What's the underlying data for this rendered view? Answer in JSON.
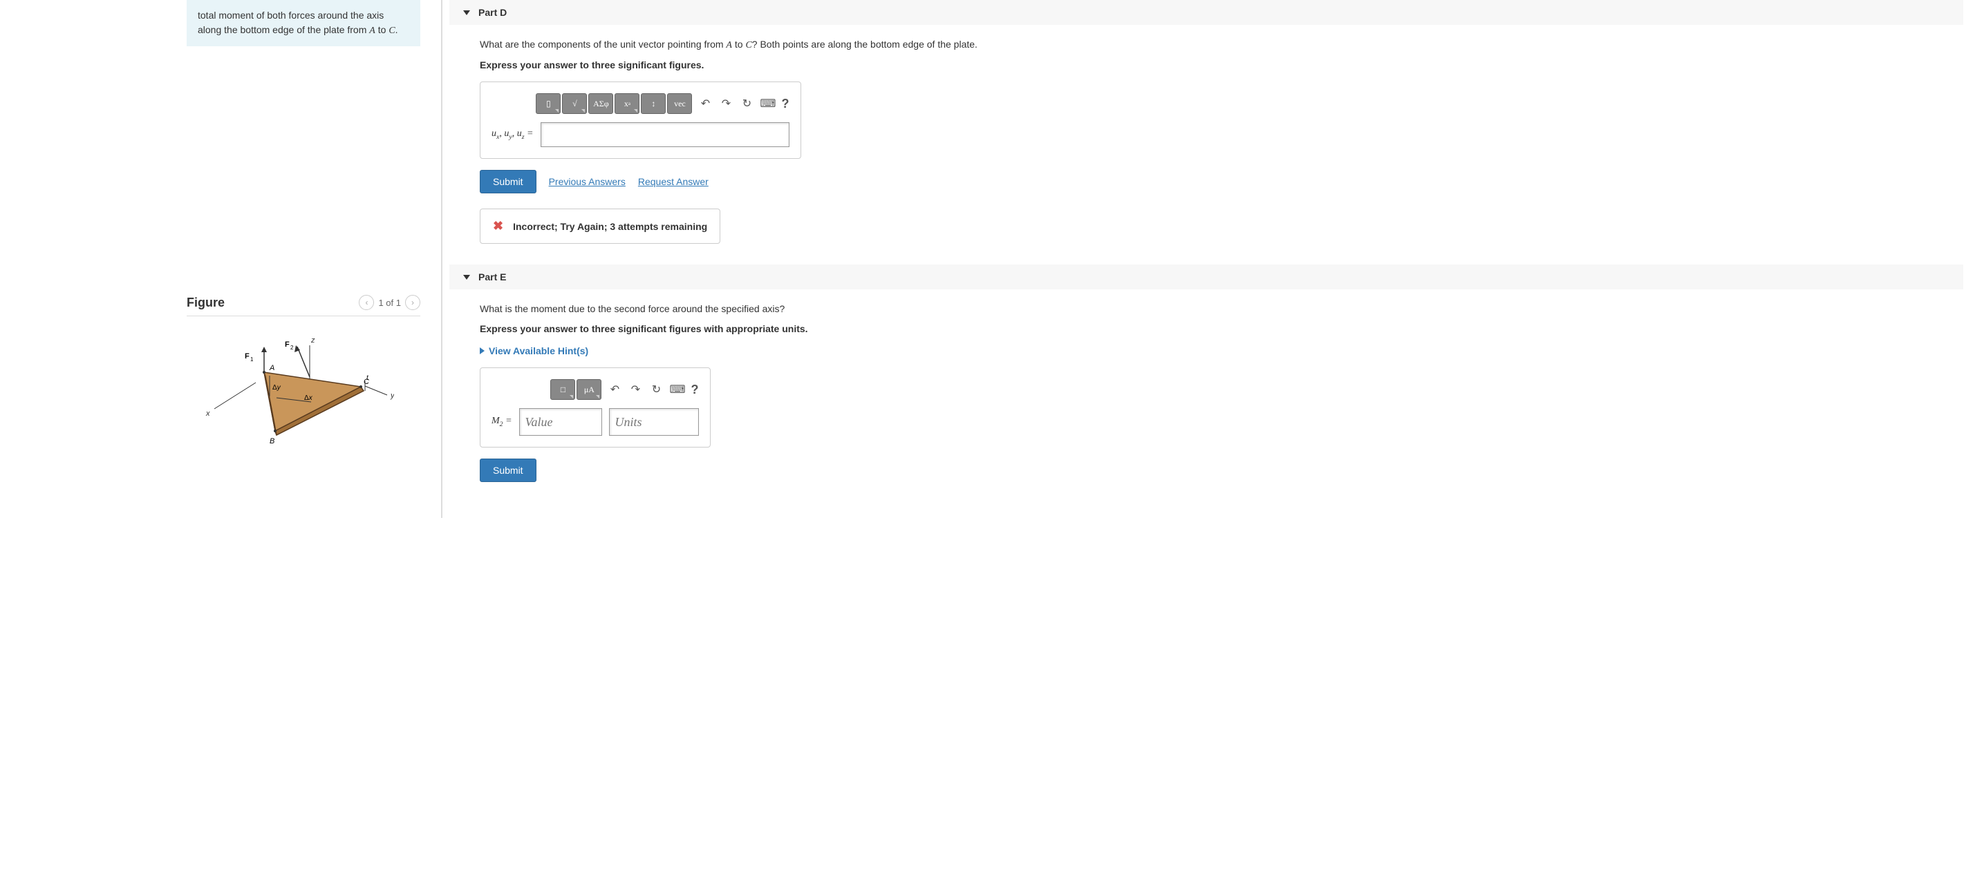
{
  "intro": "total moment of both forces around the axis along the bottom edge of the plate from A to C.",
  "figure": {
    "title": "Figure",
    "pager": "1 of 1"
  },
  "partD": {
    "title": "Part D",
    "question_pre": "What are the components of the unit vector pointing from ",
    "question_mid": " to ",
    "question_post": "? Both points are along the bottom edge of the plate.",
    "instruction": "Express your answer to three significant figures.",
    "answer_label": "uₓ, u_y, u_z =",
    "submit": "Submit",
    "prev_answers": "Previous Answers",
    "request_answer": "Request Answer",
    "feedback": "Incorrect; Try Again; 3 attempts remaining"
  },
  "partE": {
    "title": "Part E",
    "question": "What is the moment due to the second force around the specified axis?",
    "instruction": "Express your answer to three significant figures with appropriate units.",
    "hints": "View Available Hint(s)",
    "answer_label": "M₂ =",
    "value_placeholder": "Value",
    "units_placeholder": "Units",
    "submit": "Submit"
  },
  "toolbar": {
    "sqrt": "√",
    "greek": "ΑΣφ",
    "updown": "↕",
    "vec": "vec",
    "undo": "↶",
    "redo": "↷",
    "reset": "↻",
    "keyboard": "⌨",
    "help": "?",
    "frac": "□",
    "angle": "∡"
  }
}
